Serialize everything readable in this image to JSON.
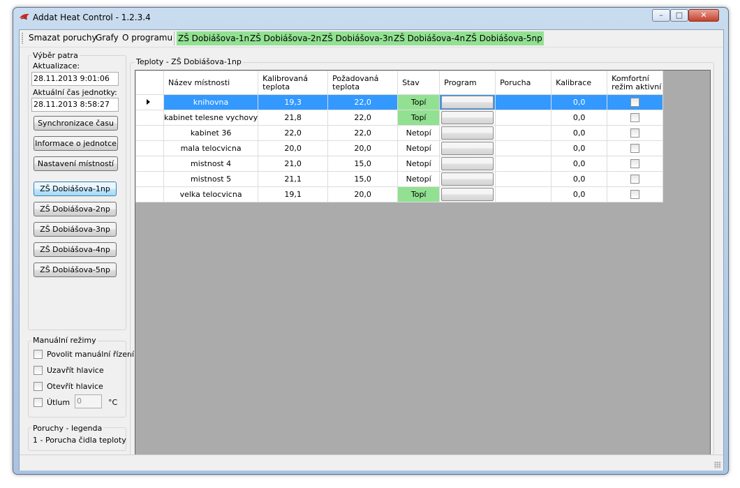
{
  "window": {
    "title": "Addat Heat Control - 1.2.3.4",
    "minimize": "–",
    "maximize": "□",
    "close": "✕"
  },
  "menu": {
    "items": [
      "Smazat poruchy",
      "Grafy",
      "O programu"
    ],
    "floor_tabs": [
      "ZŠ Dobiášova-1np",
      "ZŠ Dobiášova-2np",
      "ZŠ Dobiášova-3np",
      "ZŠ Dobiášova-4np",
      "ZŠ Dobiášova-5np"
    ]
  },
  "floor_select": {
    "group_title": "Výběr patra",
    "update_label": "Aktualizace:",
    "update_value": "28.11.2013 9:01:06",
    "unit_time_label": "Aktuální čas jednotky:",
    "unit_time_value": "28.11.2013 8:58:27",
    "buttons": [
      "Synchronizace času",
      "Informace o jednotce",
      "Nastavení místností"
    ],
    "floor_buttons": [
      "ZŠ Dobiášova-1np",
      "ZŠ Dobiášova-2np",
      "ZŠ Dobiášova-3np",
      "ZŠ Dobiášova-4np",
      "ZŠ Dobiášova-5np"
    ],
    "active_floor_index": 0
  },
  "manual": {
    "group_title": "Manuální režimy",
    "options": [
      "Povolit manuální řízení",
      "Uzavřít hlavice",
      "Otevřít hlavice"
    ],
    "attenuation_label": "Útlum",
    "attenuation_value": "0",
    "attenuation_unit": "°C"
  },
  "legend": {
    "group_title": "Poruchy - legenda",
    "text": "1 - Porucha čidla teploty"
  },
  "temps": {
    "group_title": "Teploty - ZŠ Dobiášova-1np",
    "columns": [
      "Název místnosti",
      "Kalibrovaná teplota",
      "Požadovaná teplota",
      "Stav",
      "Program",
      "Porucha",
      "Kalibrace",
      "Komfortní režim aktivní"
    ],
    "rows": [
      {
        "name": "knihovna",
        "calibrated": "19,3",
        "required": "22,0",
        "state": "Topí",
        "fault": "",
        "calibration": "0,0",
        "selected": true
      },
      {
        "name": "kabinet telesne vychovy",
        "calibrated": "21,8",
        "required": "22,0",
        "state": "Topí",
        "fault": "",
        "calibration": "0,0",
        "selected": false
      },
      {
        "name": "kabinet 36",
        "calibrated": "22,0",
        "required": "22,0",
        "state": "Netopí",
        "fault": "",
        "calibration": "0,0",
        "selected": false
      },
      {
        "name": "mala telocvicna",
        "calibrated": "20,0",
        "required": "20,0",
        "state": "Netopí",
        "fault": "",
        "calibration": "0,0",
        "selected": false
      },
      {
        "name": "mistnost 4",
        "calibrated": "21,0",
        "required": "15,0",
        "state": "Netopí",
        "fault": "",
        "calibration": "0,0",
        "selected": false
      },
      {
        "name": "mistnost 5",
        "calibrated": "21,1",
        "required": "15,0",
        "state": "Netopí",
        "fault": "",
        "calibration": "0,0",
        "selected": false
      },
      {
        "name": "velka telocvicna",
        "calibrated": "19,1",
        "required": "20,0",
        "state": "Topí",
        "fault": "",
        "calibration": "0,0",
        "selected": false
      }
    ]
  },
  "colors": {
    "heating": "#92e192",
    "selection": "#3399ff",
    "grid_background": "#ababab"
  }
}
